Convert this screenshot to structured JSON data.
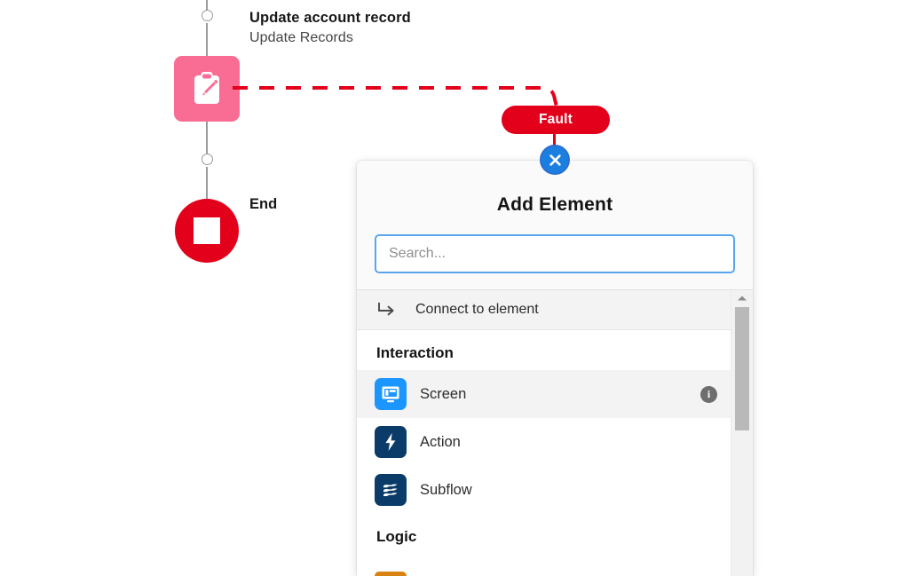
{
  "canvas": {
    "nodes": [
      {
        "id": "update-account-record",
        "title": "Update account record",
        "subtitle": "Update Records",
        "icon": "clipboard-pencil-icon",
        "color": "#f96c93"
      },
      {
        "id": "end",
        "title": "End",
        "icon": "stop-square-icon",
        "color": "#e3001b"
      }
    ],
    "fault_badge": {
      "label": "Fault",
      "color": "#e3001b"
    },
    "close_button": {
      "icon": "close-icon",
      "color": "#1b7fe0"
    },
    "connector": {
      "style": "dashed",
      "color": "#e3001b"
    }
  },
  "panel": {
    "title": "Add Element",
    "search": {
      "placeholder": "Search...",
      "value": "",
      "border_color": "#5aa5f0"
    },
    "connect_row": {
      "label": "Connect to element",
      "icon": "connect-arrow-icon"
    },
    "sections": [
      {
        "header": "Interaction",
        "items": [
          {
            "label": "Screen",
            "icon": "screen-icon",
            "color": "#1b96ff",
            "selected": true,
            "has_info": true
          },
          {
            "label": "Action",
            "icon": "lightning-bolt-icon",
            "color": "#0b3b69",
            "selected": false,
            "has_info": false
          },
          {
            "label": "Subflow",
            "icon": "subflow-waves-icon",
            "color": "#0b3b69",
            "selected": false,
            "has_info": false
          }
        ]
      },
      {
        "header": "Logic",
        "items": []
      }
    ],
    "scrollbar": {
      "up_arrow_icon": "chevron-up-icon"
    }
  }
}
